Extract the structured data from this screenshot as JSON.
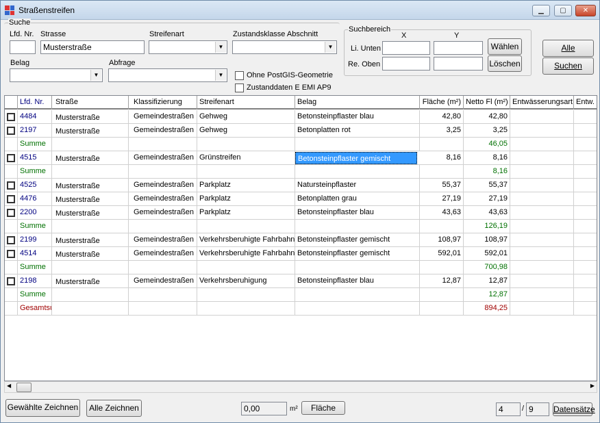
{
  "window": {
    "title": "Straßenstreifen",
    "min_icon": "minimize-icon",
    "max_icon": "maximize-icon",
    "close_icon": "close-icon"
  },
  "search": {
    "group_label": "Suche",
    "lfd_label": "Lfd. Nr.",
    "lfd_value": "",
    "strasse_label": "Strasse",
    "strasse_value": "Musterstraße",
    "streifenart_label": "Streifenart",
    "streifenart_value": "",
    "zustand_label": "Zustandsklasse Abschnitt",
    "zustand_value": "",
    "belag_label": "Belag",
    "belag_value": "",
    "abfrage_label": "Abfrage",
    "abfrage_value": "",
    "ohne_postgis_label": "Ohne PostGIS-Geometrie",
    "zustanddaten_label": "Zustanddaten E EMI AP9"
  },
  "suchbereich": {
    "group_label": "Suchbereich",
    "x_label": "X",
    "y_label": "Y",
    "li_unten_label": "Li. Unten",
    "re_oben_label": "Re. Oben",
    "waehlen_label": "Wählen",
    "loeschen_label": "Löschen"
  },
  "buttons": {
    "alle": "Alle",
    "suchen": "Suchen"
  },
  "table": {
    "columns": [
      "Lfd. Nr.",
      "Straße",
      "Klassifizierung",
      "Streifenart",
      "Belag",
      "Fläche (m²)",
      "Netto Fl (m²)",
      "Entwässerungsart",
      "Entw."
    ],
    "rows": [
      {
        "type": "data",
        "lfd": "4484",
        "strasse": "Musterstraße",
        "klass": "Gemeindestraßen",
        "streifenart": "Gehweg",
        "belag": "Betonsteinpflaster blau",
        "flaeche": "42,80",
        "netto": "42,80"
      },
      {
        "type": "data",
        "lfd": "2197",
        "strasse": "Musterstraße",
        "klass": "Gemeindestraßen",
        "streifenart": "Gehweg",
        "belag": "Betonplatten rot",
        "flaeche": "3,25",
        "netto": "3,25"
      },
      {
        "type": "sum",
        "lfd": "Summe",
        "netto": "46,05"
      },
      {
        "type": "data",
        "lfd": "4515",
        "strasse": "Musterstraße",
        "klass": "Gemeindestraßen",
        "streifenart": "Grünstreifen",
        "belag": "Betonsteinpflaster gemischt",
        "flaeche": "8,16",
        "netto": "8,16",
        "selected_belag": true
      },
      {
        "type": "sum",
        "lfd": "Summe",
        "netto": "8,16"
      },
      {
        "type": "data",
        "lfd": "4525",
        "strasse": "Musterstraße",
        "klass": "Gemeindestraßen",
        "streifenart": "Parkplatz",
        "belag": "Natursteinpflaster",
        "flaeche": "55,37",
        "netto": "55,37"
      },
      {
        "type": "data",
        "lfd": "4476",
        "strasse": "Musterstraße",
        "klass": "Gemeindestraßen",
        "streifenart": "Parkplatz",
        "belag": "Betonplatten grau",
        "flaeche": "27,19",
        "netto": "27,19"
      },
      {
        "type": "data",
        "lfd": "2200",
        "strasse": "Musterstraße",
        "klass": "Gemeindestraßen",
        "streifenart": "Parkplatz",
        "belag": "Betonsteinpflaster blau",
        "flaeche": "43,63",
        "netto": "43,63"
      },
      {
        "type": "sum",
        "lfd": "Summe",
        "netto": "126,19"
      },
      {
        "type": "data",
        "lfd": "2199",
        "strasse": "Musterstraße",
        "klass": "Gemeindestraßen",
        "streifenart": "Verkehrsberuhigte Fahrbahn",
        "belag": "Betonsteinpflaster gemischt",
        "flaeche": "108,97",
        "netto": "108,97"
      },
      {
        "type": "data",
        "lfd": "4514",
        "strasse": "Musterstraße",
        "klass": "Gemeindestraßen",
        "streifenart": "Verkehrsberuhigte Fahrbahn",
        "belag": "Betonsteinpflaster gemischt",
        "flaeche": "592,01",
        "netto": "592,01"
      },
      {
        "type": "sum",
        "lfd": "Summe",
        "netto": "700,98"
      },
      {
        "type": "data",
        "lfd": "2198",
        "strasse": "Musterstraße",
        "klass": "Gemeindestraßen",
        "streifenart": "Verkehrsberuhigung",
        "belag": "Betonsteinpflaster blau",
        "flaeche": "12,87",
        "netto": "12,87"
      },
      {
        "type": "sum",
        "lfd": "Summe",
        "netto": "12,87"
      },
      {
        "type": "total",
        "lfd": "Gesamtsumme",
        "netto": "894,25"
      }
    ]
  },
  "colors": {
    "lfd": "#000080",
    "sum": "#007000",
    "total": "#a00000",
    "selection": "#3399ff"
  },
  "footer": {
    "gewaehlte_label": "Gewählte Zeichnen",
    "alle_zeichnen_label": "Alle Zeichnen",
    "area_value": "0,00",
    "area_unit": "m²",
    "flaeche_label": "Fläche",
    "record_current": "4",
    "record_sep": "/",
    "record_total": "9",
    "datensaetze_label": "Datensätze"
  }
}
